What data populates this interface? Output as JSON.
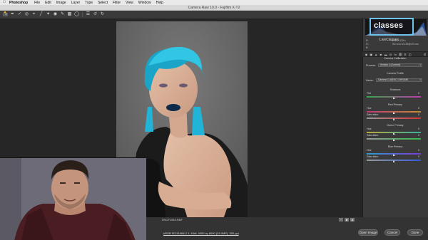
{
  "menubar": {
    "app": "Photoshop",
    "items": [
      "File",
      "Edit",
      "Image",
      "Layer",
      "Type",
      "Select",
      "Filter",
      "View",
      "Window",
      "Help"
    ]
  },
  "dialog": {
    "title": "Camera Raw 10.0  -  Fujifilm X-T2"
  },
  "toolbar": {
    "icons": [
      "zoom-icon",
      "hand-icon",
      "white-balance-icon",
      "color-sampler-icon",
      "target-adjust-icon",
      "crop-icon",
      "straighten-icon",
      "spot-removal-icon",
      "red-eye-icon",
      "adjustment-brush-icon",
      "graduated-filter-icon",
      "radial-filter-icon",
      "preferences-icon",
      "rotate-ccw-icon",
      "rotate-cw-icon"
    ]
  },
  "preview": {
    "filename": "DSCF1944.RAF",
    "zoom_buttons": [
      "Y",
      "▣",
      "▦"
    ],
    "info_link": "sRGB IEC61966-2.1; 8 bit; 4000 by 6000 (24.0MP); 300 ppi"
  },
  "buttons": {
    "open": "Open Image",
    "cancel": "Cancel",
    "done": "Done"
  },
  "overlay": {
    "logo_text": "classes",
    "brand_caption": "LiveClasses"
  },
  "camera_info": {
    "r_label": "R:",
    "g_label": "G:",
    "b_label": "B:",
    "exposure": "f/5.6   1/125 s",
    "iso_lens": "ISO 100   16-55@40 mm"
  },
  "panel": {
    "title": "Camera Calibration",
    "process_label": "Process:",
    "process_value": "Version 4 (Current)",
    "profile_heading": "Camera Profile",
    "name_label": "Name:",
    "name_value": "Camera CLASSIC CHROME",
    "sections": [
      {
        "heading": "Shadows",
        "sliders": [
          {
            "label": "Tint",
            "value": "0",
            "pos": 0.5,
            "colors": [
              "#35a845",
              "#c13ab1"
            ]
          }
        ]
      },
      {
        "heading": "Red Primary",
        "sliders": [
          {
            "label": "Hue",
            "value": "0",
            "pos": 0.5,
            "colors": [
              "#c23a7a",
              "#c98f2f"
            ]
          },
          {
            "label": "Saturation",
            "value": "0",
            "pos": 0.5,
            "colors": [
              "#9a9a9a",
              "#d93434"
            ]
          }
        ]
      },
      {
        "heading": "Green Primary",
        "sliders": [
          {
            "label": "Hue",
            "value": "0",
            "pos": 0.5,
            "colors": [
              "#b7a93a",
              "#37b09a"
            ]
          },
          {
            "label": "Saturation",
            "value": "0",
            "pos": 0.5,
            "colors": [
              "#9a9a9a",
              "#33b84a"
            ]
          }
        ]
      },
      {
        "heading": "Blue Primary",
        "sliders": [
          {
            "label": "Hue",
            "value": "0",
            "pos": 0.5,
            "colors": [
              "#2f9fd0",
              "#7a3ad6"
            ]
          },
          {
            "label": "Saturation",
            "value": "0",
            "pos": 0.5,
            "colors": [
              "#9a9a9a",
              "#2f5fd9"
            ]
          }
        ]
      }
    ]
  },
  "colors": {
    "accent_blue": "#6fc2e9",
    "panel_bg": "#3a3a3a",
    "canvas_bg": "#262626"
  }
}
